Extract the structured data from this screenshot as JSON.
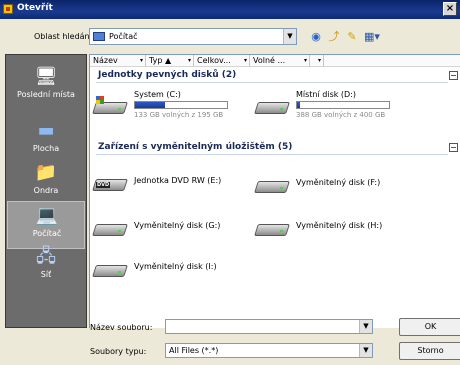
{
  "window": {
    "title": "Otevřít",
    "close_glyph": "×"
  },
  "look_in": {
    "label": "Oblast hledání:",
    "value": "Počítač",
    "icon": "computer-icon"
  },
  "toolbar": {
    "back_icon": "back-icon",
    "up_icon": "up-folder-icon",
    "new_folder_icon": "new-folder-icon",
    "views_icon": "views-menu-icon"
  },
  "places": [
    {
      "label": "Poslední místa",
      "icon": "recent-places-icon"
    },
    {
      "label": "Plocha",
      "icon": "desktop-icon"
    },
    {
      "label": "Ondra",
      "icon": "user-folder-icon"
    },
    {
      "label": "Počítač",
      "icon": "computer-icon",
      "selected": true
    },
    {
      "label": "Síť",
      "icon": "network-icon"
    }
  ],
  "columns": [
    "Název",
    "Typ",
    "Celkov...",
    "Volné ..."
  ],
  "groups": {
    "hdd": {
      "title": "Jednotky pevných disků (2)",
      "collapse": "−"
    },
    "removable": {
      "title": "Zařízení s vyměnitelným úložištěm (5)",
      "collapse": "−"
    }
  },
  "hard_drives": [
    {
      "name": "System (C:)",
      "free_text": "133 GB volných z 195 GB",
      "used_fraction": 0.32,
      "icon": "system-drive-icon"
    },
    {
      "name": "Místní disk (D:)",
      "free_text": "388 GB volných z 400 GB",
      "used_fraction": 0.03,
      "icon": "local-disk-icon"
    }
  ],
  "removable_drives": [
    {
      "name": "Jednotka DVD RW (E:)",
      "icon": "dvd-drive-icon",
      "badge": "DVD"
    },
    {
      "name": "Vyměnitelný disk (F:)",
      "icon": "removable-disk-icon"
    },
    {
      "name": "Vyměnitelný disk (G:)",
      "icon": "removable-disk-icon"
    },
    {
      "name": "Vyměnitelný disk (H:)",
      "icon": "removable-disk-icon"
    },
    {
      "name": "Vyměnitelný disk (I:)",
      "icon": "removable-disk-icon"
    }
  ],
  "file_name": {
    "label": "Název souboru:",
    "value": ""
  },
  "file_type": {
    "label": "Soubory typu:",
    "value": "All Files (*.*)"
  },
  "buttons": {
    "ok": "OK",
    "cancel": "Storno"
  }
}
